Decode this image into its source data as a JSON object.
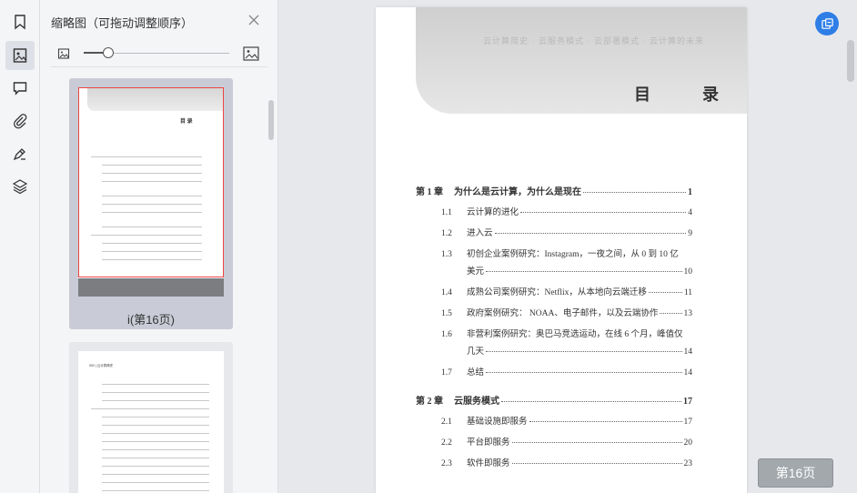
{
  "sidebar": {
    "rail_icons": [
      "bookmark-icon",
      "thumbnail-icon",
      "comment-icon",
      "attachment-icon",
      "signature-icon",
      "layers-icon"
    ]
  },
  "thumbnails": {
    "title": "缩略图（可拖动调整顺序）",
    "zoom_level": 0.15,
    "items": [
      {
        "label": "i(第16页)",
        "selected": true,
        "page_heading": "目   录"
      },
      {
        "label": "",
        "selected": false,
        "page_heading": "002 | 云计算简史"
      }
    ]
  },
  "document": {
    "banner_faint_text": "云计算简史 · 云服务模式 · 云部署模式 · 云计算的未来",
    "heading": "目 录",
    "toc": [
      {
        "num": "第 1 章",
        "title": "为什么是云计算，为什么是现在",
        "page": "1",
        "chapter": true
      },
      {
        "num": "1.1",
        "title": "云计算的进化",
        "page": "4",
        "chapter": false
      },
      {
        "num": "1.2",
        "title": "进入云",
        "page": "9",
        "chapter": false
      },
      {
        "num": "1.3",
        "title": "初创企业案例研究：Instagram，一夜之间，从 0 到 10 亿",
        "cont": "美元",
        "page": "10",
        "chapter": false
      },
      {
        "num": "1.4",
        "title": "成熟公司案例研究：Netflix，从本地向云端迁移",
        "page": "11",
        "chapter": false
      },
      {
        "num": "1.5",
        "title": "政府案例研究：  NOAA、电子邮件，以及云端协作",
        "page": "13",
        "chapter": false
      },
      {
        "num": "1.6",
        "title": "非营利案例研究：奥巴马竞选运动，在线 6 个月，峰值仅",
        "cont": "几天",
        "page": "14",
        "chapter": false
      },
      {
        "num": "1.7",
        "title": "总结",
        "page": "14",
        "chapter": false
      },
      {
        "num": "第 2 章",
        "title": "云服务模式",
        "page": "17",
        "chapter": true
      },
      {
        "num": "2.1",
        "title": "基础设施即服务",
        "page": "17",
        "chapter": false
      },
      {
        "num": "2.2",
        "title": "平台即服务",
        "page": "20",
        "chapter": false
      },
      {
        "num": "2.3",
        "title": "软件即服务",
        "page": "23",
        "chapter": false
      }
    ]
  },
  "page_indicator": "第16页",
  "colors": {
    "accent": "#2e7ee6",
    "selection": "#ee4444"
  }
}
